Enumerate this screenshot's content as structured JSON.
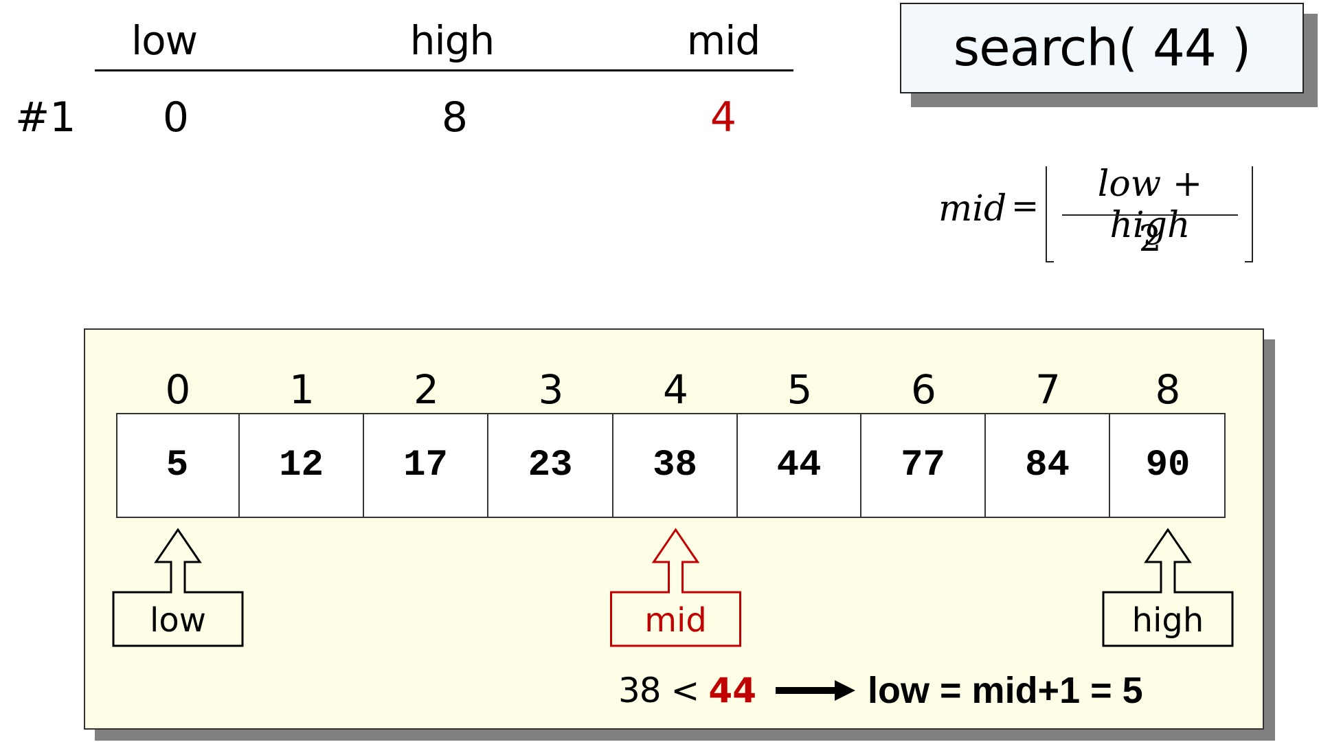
{
  "trace_table": {
    "headers": [
      "low",
      "high",
      "mid"
    ],
    "rows": [
      {
        "label": "#1",
        "low": "0",
        "high": "8",
        "mid": "4"
      }
    ]
  },
  "search_call": "search( 44 )",
  "formula": {
    "lhs": "mid",
    "eq": "=",
    "numerator": "low + high",
    "denominator": "2",
    "operation": "floor"
  },
  "array": {
    "indices": [
      "0",
      "1",
      "2",
      "3",
      "4",
      "5",
      "6",
      "7",
      "8"
    ],
    "values": [
      "5",
      "12",
      "17",
      "23",
      "38",
      "44",
      "77",
      "84",
      "90"
    ]
  },
  "pointers": [
    {
      "name": "low",
      "label": "low",
      "index": 0,
      "color": "#000000"
    },
    {
      "name": "mid",
      "label": "mid",
      "index": 4,
      "color": "#c00000"
    },
    {
      "name": "high",
      "label": "high",
      "index": 8,
      "color": "#000000"
    }
  ],
  "explanation": {
    "comparison_left": "38 <",
    "target": "44",
    "result": "low = mid+1 = 5"
  },
  "colors": {
    "accent_red": "#c00000",
    "panel_bg": "#fefee6",
    "search_box_bg": "#f3f8fc",
    "shadow": "#808080"
  }
}
